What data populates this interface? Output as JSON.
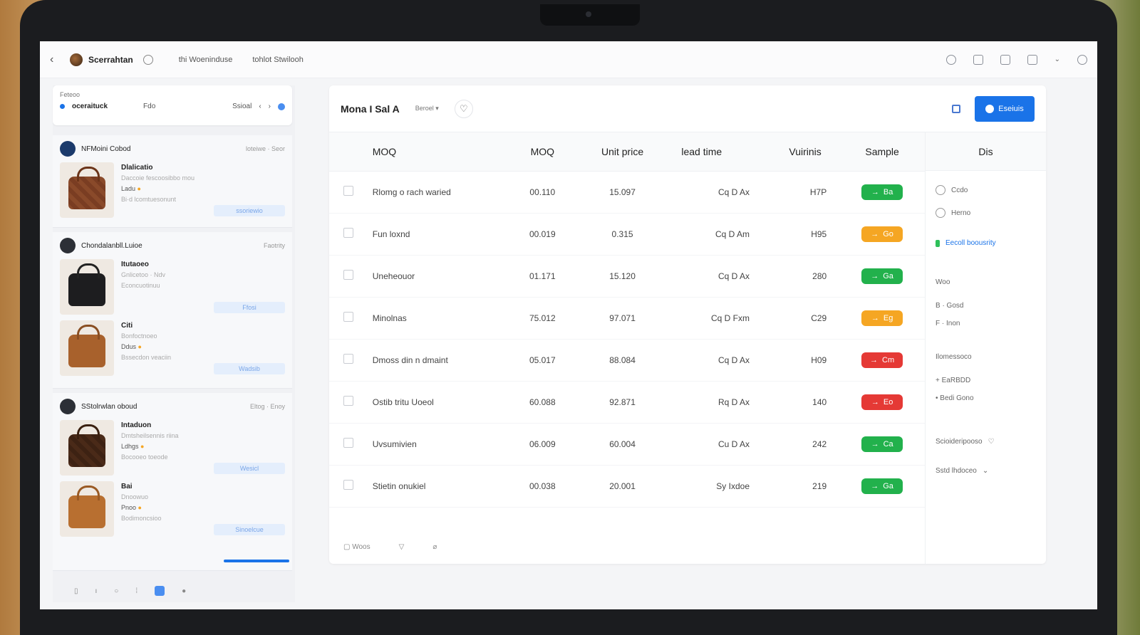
{
  "topbar": {
    "brand": "Scerrahtan",
    "nav": [
      "thi Woeninduse",
      "tohlot Stwilooh"
    ]
  },
  "filter": {
    "label": "Feteoo",
    "active": "oceraituck",
    "option2": "Fdo",
    "option3": "Ssioal"
  },
  "suppliers": [
    {
      "name": "NFMoini Cobod",
      "meta": "loteiwe · Seor",
      "products": [
        {
          "name": "Dlalicatio",
          "line1": "Daccoie fescoosibbo mou",
          "line2": "Ladu",
          "line3": "Bi·d lcomtuesonunt",
          "btn": "ssoriewio"
        }
      ]
    },
    {
      "name": "Chondalanbll.Luioe",
      "meta": "Faotrity",
      "products": [
        {
          "name": "Itutaoeo",
          "line1": "Gnlicetoo · Ndv",
          "line2": "",
          "line3": "Econcuotinuu",
          "btn": "Ffosi"
        },
        {
          "name": "Citi",
          "line1": "Bonfoctnoeo",
          "line2": "Ddus",
          "line3": "Bssecdon veaciin",
          "btn": "Wadsib"
        }
      ]
    },
    {
      "name": "SStolrwlan oboud",
      "meta": "Eltog · Enoy",
      "products": [
        {
          "name": "Intaduon",
          "line1": "Dmtsheilsennis riina",
          "line2": "Ldhgs",
          "line3": "Bocooeo toeode",
          "btn": "Wesicl"
        },
        {
          "name": "Bai",
          "line1": "Dnoowuo",
          "line2": "Pnoo",
          "line3": "Bodimoncsioo",
          "btn": "Sinoelcue"
        }
      ]
    }
  ],
  "main": {
    "title": "Mona I Sal A",
    "dropdown": "Beroel",
    "primary_button": "Eseiuis",
    "headers": {
      "name": "MOQ",
      "moq": "MOQ",
      "price": "Unit price",
      "lead": "lead time",
      "variants": "Vuirinis",
      "sample": "Sample",
      "side": "Dis"
    },
    "rows": [
      {
        "name": "Rlomg o rach waried",
        "moq": "00.110",
        "price": "15.097",
        "lead": "Cq D Ax",
        "var": "H7P",
        "sample": "Ba",
        "color": "#22b14c"
      },
      {
        "name": "Fun loxnd",
        "moq": "00.019",
        "price": "0.315",
        "lead": "Cq D Am",
        "var": "H95",
        "sample": "Go",
        "color": "#f5a623"
      },
      {
        "name": "Uneheouor",
        "moq": "01.171",
        "price": "15.120",
        "lead": "Cq D Ax",
        "var": "280",
        "sample": "Ga",
        "color": "#22b14c"
      },
      {
        "name": "Minolnas",
        "moq": "75.012",
        "price": "97.071",
        "lead": "Cq D Fxm",
        "var": "C29",
        "sample": "Eg",
        "color": "#f5a623"
      },
      {
        "name": "Dmoss din n dmaint",
        "moq": "05.017",
        "price": "88.084",
        "lead": "Cq D Ax",
        "var": "H09",
        "sample": "Cm",
        "color": "#e53935"
      },
      {
        "name": "Ostib tritu Uoeol",
        "moq": "60.088",
        "price": "92.871",
        "lead": "Rq D Ax",
        "var": "140",
        "sample": "Eo",
        "color": "#e53935"
      },
      {
        "name": "Uvsumivien",
        "moq": "06.009",
        "price": "60.004",
        "lead": "Cu D Ax",
        "var": "242",
        "sample": "Ca",
        "color": "#22b14c"
      },
      {
        "name": "Stietin onukiel",
        "moq": "00.038",
        "price": "20.001",
        "lead": "Sy Ixdoe",
        "var": "219",
        "sample": "Ga",
        "color": "#22b14c"
      }
    ],
    "footer": "Woos"
  },
  "side": {
    "items": [
      "Ccdo",
      "Herno",
      "Eecoll boousrity",
      "Woo",
      "B · Gosd",
      "F · Inon",
      "Ilomessoco",
      "+ EaRBDD",
      "• Bedi Gono",
      "Scioideripooso",
      "Sstd lhdoceo"
    ]
  }
}
